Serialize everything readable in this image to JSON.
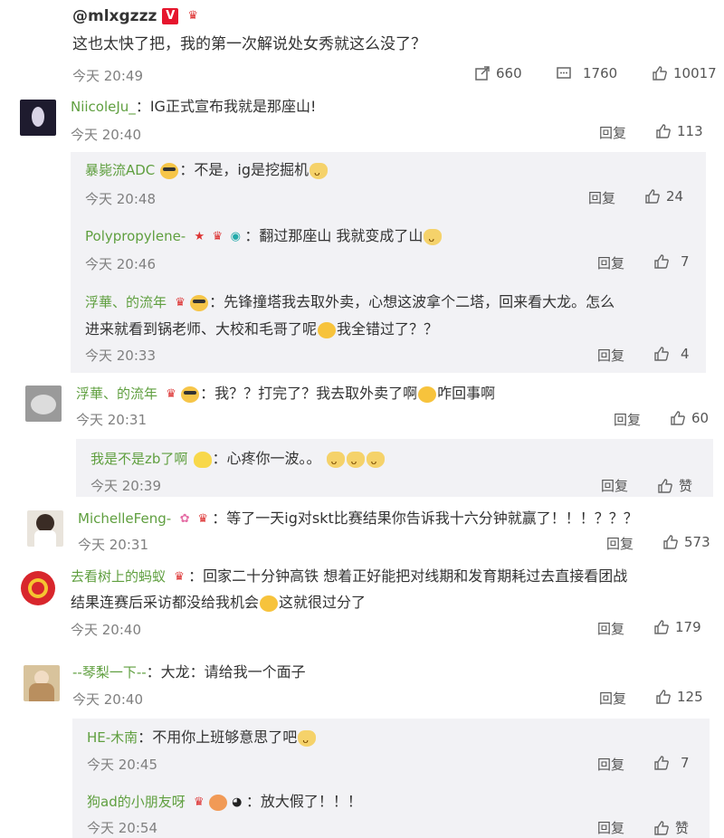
{
  "post": {
    "author": "@mlxgzzz",
    "text": "这也太快了把，我的第一次解说处女秀就这么没了？",
    "time": "今天 20:49",
    "share_count": "660",
    "comment_count": "1760",
    "like_count": "10017"
  },
  "common": {
    "reply_label": "回复",
    "like_word": "赞"
  },
  "comments": [
    {
      "name": "NiicoleJu_",
      "text": "IG正式宣布我就是那座山!",
      "time": "今天 20:40",
      "likes": "113",
      "replies": [
        {
          "name": "暴毙流ADC",
          "text": "不是，ig是挖掘机",
          "time": "今天 20:48",
          "likes": "24"
        },
        {
          "name": "Polypropylene-",
          "text": "翻过那座山 我就变成了山",
          "time": "今天 20:46",
          "likes": "7"
        },
        {
          "name": "浮華、的流年",
          "text": "先锋撞塔我去取外卖，心想这波拿个二塔，回来看大龙。怎么",
          "text2": "进来就看到锅老师、大校和毛哥了呢",
          "text3": "我全错过了？？",
          "time": "今天 20:33",
          "likes": "4"
        }
      ]
    },
    {
      "name": "浮華、的流年",
      "text": "我？？打完了？我去取外卖了啊",
      "text2": "咋回事啊",
      "time": "今天 20:31",
      "likes": "60",
      "replies": [
        {
          "name": "我是不是zb了啊",
          "text": "心疼你一波。。",
          "time": "今天 20:39",
          "likes": "赞"
        }
      ]
    },
    {
      "name": "MichelleFeng-",
      "text": "等了一天ig对skt比赛结果你告诉我十六分钟就赢了！！！？？？",
      "time": "今天 20:31",
      "likes": "573"
    },
    {
      "name": "去看树上的蚂蚁",
      "text": "回家二十分钟高铁 想着正好能把对线期和发育期耗过去直接看团战",
      "text2": "结果连赛后采访都没给我机会",
      "text3": "这就很过分了",
      "time": "今天 20:40",
      "likes": "179"
    },
    {
      "name": "--琴梨一下--",
      "text": "大龙：请给我一个面子",
      "time": "今天 20:40",
      "likes": "125",
      "replies": [
        {
          "name": "HE-木南",
          "text": "不用你上班够意思了吧",
          "time": "今天 20:45",
          "likes": "7"
        },
        {
          "name": "狗ad的小朋友呀",
          "text": "放大假了！！！",
          "time": "今天 20:54",
          "likes": "赞"
        }
      ]
    }
  ]
}
